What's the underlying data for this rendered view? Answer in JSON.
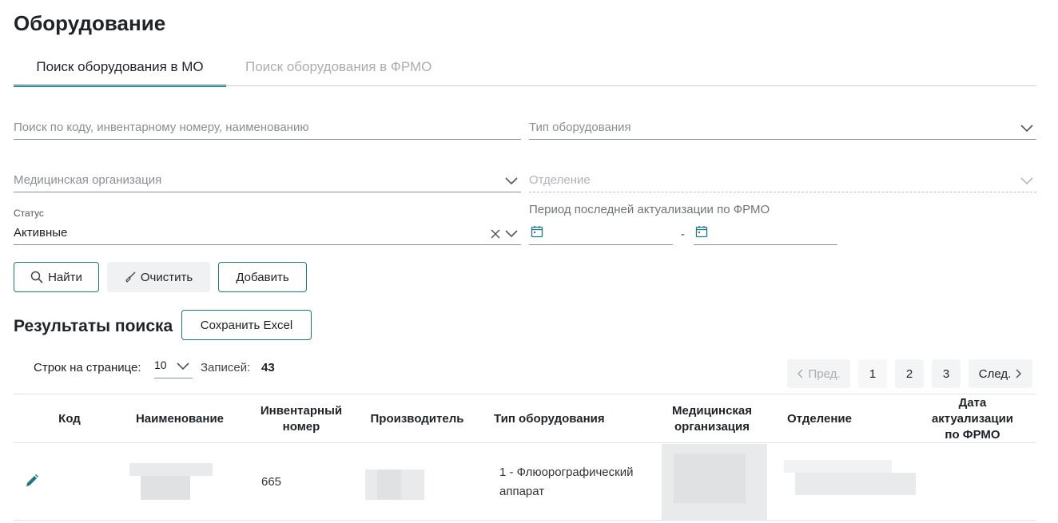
{
  "page_title": "Оборудование",
  "tabs": [
    {
      "label": "Поиск оборудования в МО",
      "active": true
    },
    {
      "label": "Поиск оборудования в ФРМО",
      "active": false
    }
  ],
  "filters": {
    "search_placeholder": "Поиск по коду, инвентарному номеру, наименованию",
    "equipment_type_placeholder": "Тип оборудования",
    "med_org_placeholder": "Медицинская организация",
    "department_placeholder": "Отделение",
    "status_label": "Статус",
    "status_value": "Активные",
    "period_label": "Период последней актуализации по ФРМО",
    "period_separator": "-"
  },
  "actions": {
    "find_label": "Найти",
    "clear_label": "Очистить",
    "add_label": "Добавить"
  },
  "results": {
    "title": "Результаты поиска",
    "export_label": "Сохранить Excel",
    "rows_per_page_label": "Строк на странице:",
    "rows_per_page_value": "10",
    "records_label": "Записей:",
    "records_count": "43"
  },
  "pagination": {
    "prev_label": "Пред.",
    "next_label": "След.",
    "pages": [
      "1",
      "2",
      "3"
    ],
    "current_page": "1"
  },
  "table": {
    "headers": {
      "code": "Код",
      "name": "Наименование",
      "inventory_line1": "Инвентарный",
      "inventory_line2": "номер",
      "manufacturer": "Производитель",
      "type": "Тип оборудования",
      "org_line1": "Медицинская",
      "org_line2": "организация",
      "dept": "Отделение",
      "date_line1": "Дата",
      "date_line2": "актуализации",
      "date_line3": "по ФРМО"
    },
    "rows": [
      {
        "inventory_number": "665",
        "type_line1": "1 - Флюорографический",
        "type_line2": "аппарат"
      }
    ]
  },
  "colors": {
    "accent": "#197a87",
    "border": "#8a9096",
    "muted_text": "#8a8f95"
  }
}
